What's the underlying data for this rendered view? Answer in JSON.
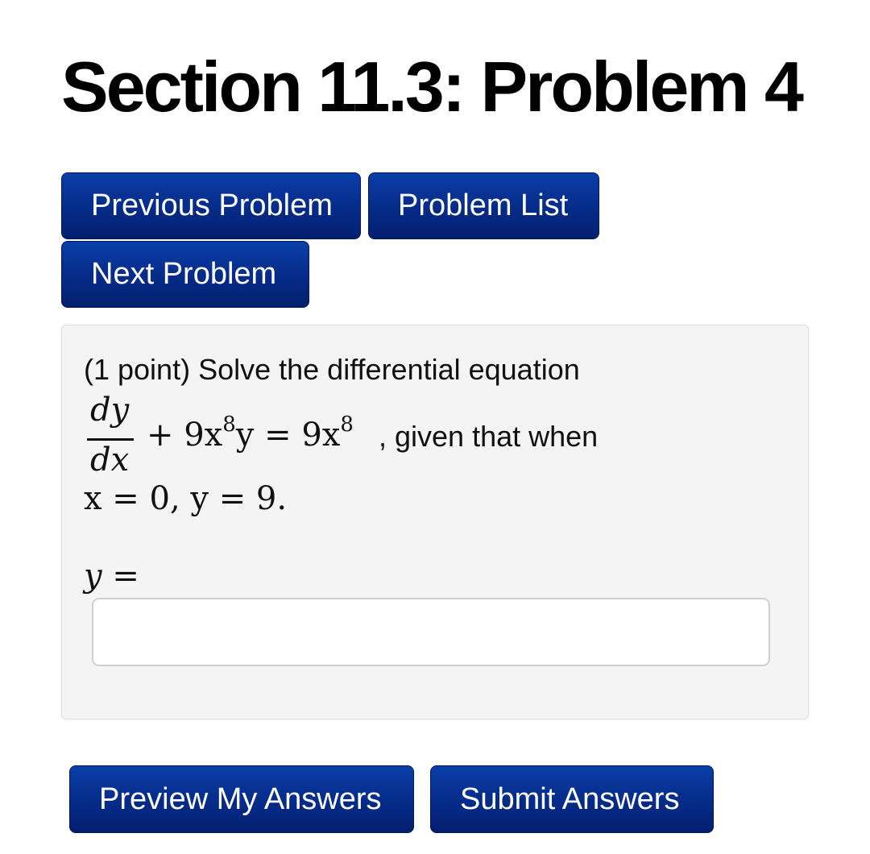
{
  "page_title": "Section 11.3: Problem 4",
  "nav": {
    "previous_label": "Previous Problem",
    "list_label": "Problem List",
    "next_label": "Next Problem"
  },
  "problem": {
    "intro": "(1 point) Solve the differential equation",
    "equation": {
      "numerator": "dy",
      "denominator": "dx",
      "lhs_rest_prefix": "+ 9x",
      "exponent_1": "8",
      "lhs_rest_suffix": "y = 9x",
      "exponent_2": "8",
      "trailing_text": ", given that when"
    },
    "condition": "x = 0, y = 9.",
    "answer_label": "y =",
    "answer_value": "",
    "answer_placeholder": ""
  },
  "actions": {
    "preview_label": "Preview My Answers",
    "submit_label": "Submit Answers"
  },
  "colors": {
    "button_blue": "#062e8e",
    "box_background": "#f4f4f4"
  }
}
